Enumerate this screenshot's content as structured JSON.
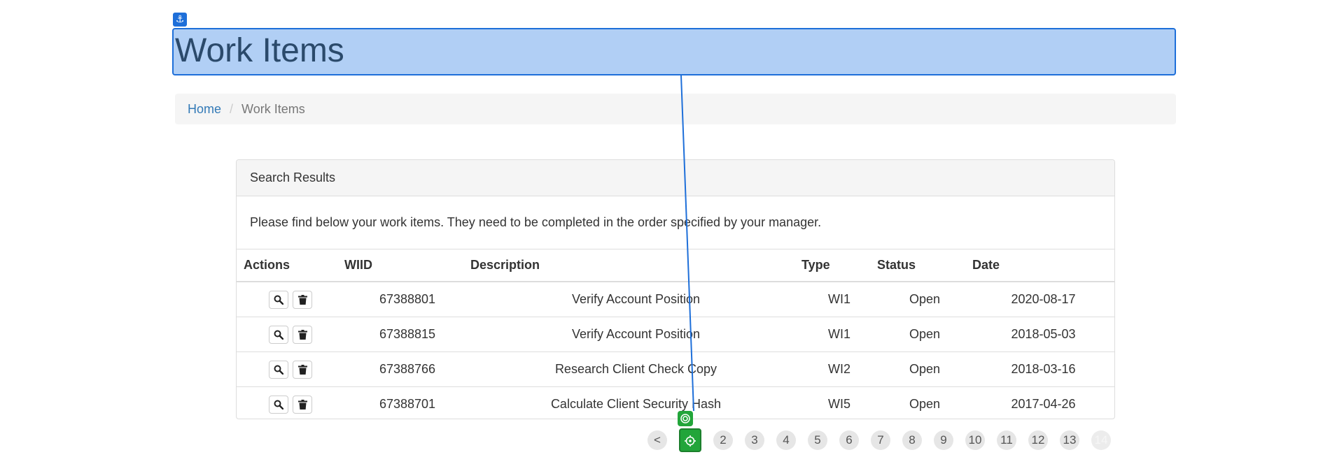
{
  "page": {
    "title": "Work Items"
  },
  "breadcrumb": {
    "home": "Home",
    "separator": "/",
    "current": "Work Items"
  },
  "panel": {
    "heading": "Search Results",
    "body": "Please find below your work items. They need to be completed in the order specified by your manager."
  },
  "table": {
    "headers": {
      "actions": "Actions",
      "wiid": "WIID",
      "description": "Description",
      "type": "Type",
      "status": "Status",
      "date": "Date"
    },
    "rows": [
      {
        "wiid": "67388801",
        "description": "Verify Account Position",
        "type": "WI1",
        "status": "Open",
        "date": "2020-08-17"
      },
      {
        "wiid": "67388815",
        "description": "Verify Account Position",
        "type": "WI1",
        "status": "Open",
        "date": "2018-05-03"
      },
      {
        "wiid": "67388766",
        "description": "Research Client Check Copy",
        "type": "WI2",
        "status": "Open",
        "date": "2018-03-16"
      },
      {
        "wiid": "67388701",
        "description": "Calculate Client Security Hash",
        "type": "WI5",
        "status": "Open",
        "date": "2017-04-26"
      }
    ],
    "row_icons": [
      "search-icon",
      "trash-icon"
    ]
  },
  "pager": {
    "prev": "<",
    "pages": [
      "1",
      "2",
      "3",
      "4",
      "5",
      "6",
      "7",
      "8",
      "9",
      "10",
      "11",
      "12",
      "13",
      "14"
    ],
    "current": "1",
    "disabled": "14"
  },
  "overlay": {
    "icons": [
      "anchor-icon",
      "target-icon",
      "crosshair-icon"
    ],
    "highlight_color": "#1e6fd9",
    "target_color": "#22a53a"
  },
  "colors": {
    "link": "#337ab7",
    "title": "#2b4a6b"
  }
}
